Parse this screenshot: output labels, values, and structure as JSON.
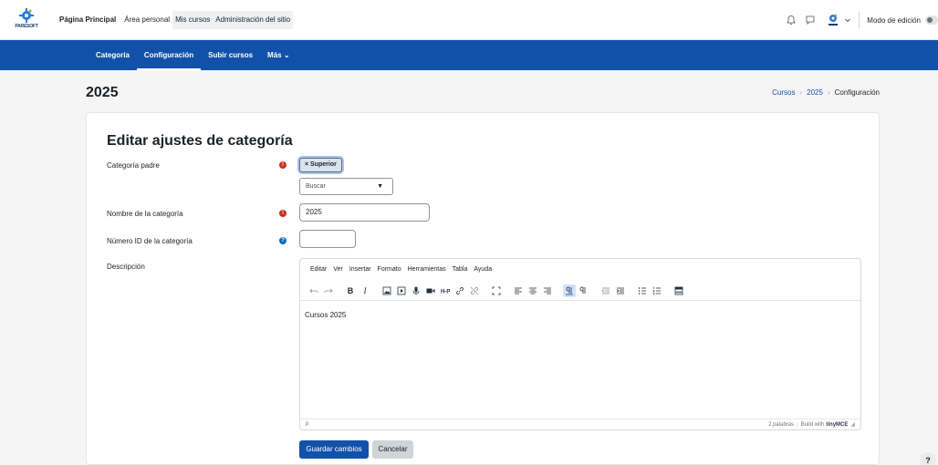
{
  "brand": {
    "logo_text": "PARESOFT",
    "accent": "#1151a9"
  },
  "topnav": {
    "items": [
      "Página Principal",
      "Área personal",
      "Mis cursos",
      "Administración del sitio"
    ]
  },
  "topright": {
    "icons": [
      "bell-icon",
      "chat-icon",
      "user-avatar",
      "chevron-down-icon"
    ],
    "edit_mode_label": "Modo de edición",
    "edit_mode_on": false
  },
  "secnav": {
    "tabs": [
      "Categoría",
      "Configuración",
      "Subir cursos",
      "Más ⌄"
    ],
    "active_index": 1
  },
  "page": {
    "title": "2025",
    "breadcrumb": [
      "Cursos",
      "2025",
      "Configuración"
    ]
  },
  "form": {
    "heading": "Editar ajustes de categoría",
    "parent_label": "Categoría padre",
    "parent_chip": "× Superior",
    "search_placeholder": "Buscar",
    "name_label": "Nombre de la categoría",
    "name_value": "2025",
    "idnumber_label": "Número ID de la categoría",
    "idnumber_value": "",
    "description_label": "Descripción",
    "required_icon": "!",
    "help_icon": "?"
  },
  "editor": {
    "menu": [
      "Editar",
      "Ver",
      "Insertar",
      "Formato",
      "Herramientas",
      "Tabla",
      "Ayuda"
    ],
    "bold": "B",
    "italic": "I",
    "content": "Cursos 2025",
    "path": "p",
    "word_count": "2 palabras",
    "build_with": "Build with",
    "brand": "tinyMCE"
  },
  "buttons": {
    "save": "Guardar cambios",
    "cancel": "Cancelar"
  },
  "help_float": "?"
}
